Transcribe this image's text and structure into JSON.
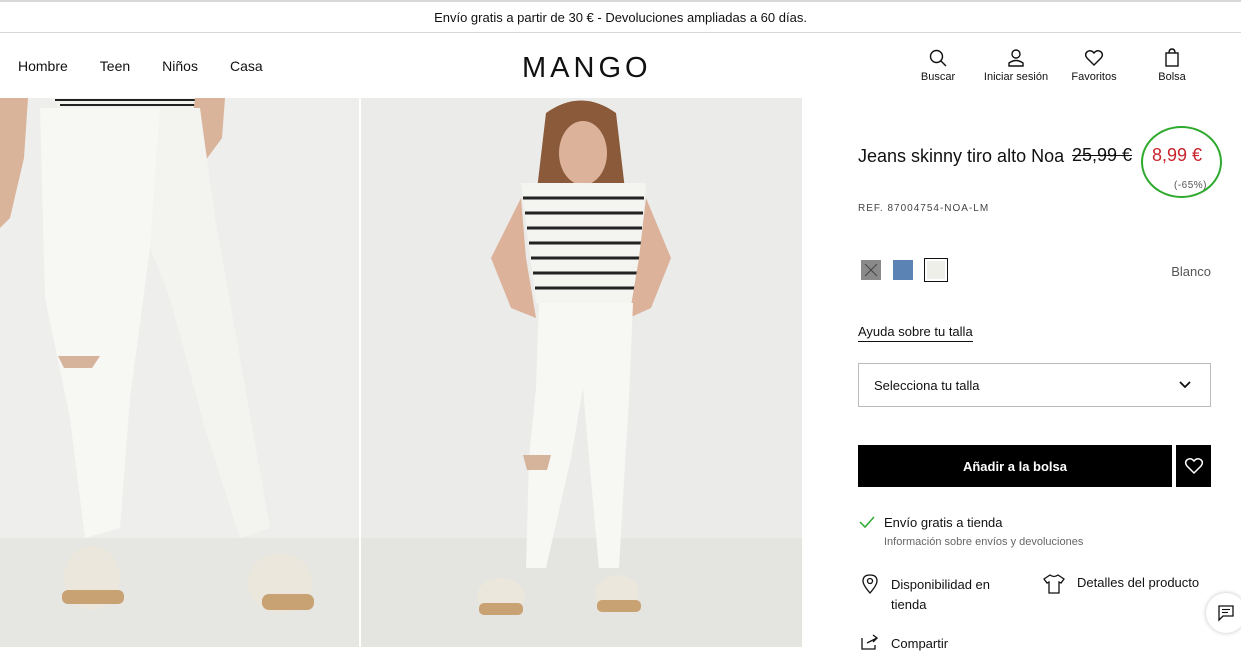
{
  "banner": {
    "text": "Envío gratis a partir de 30 € - Devoluciones ampliadas a 60 días."
  },
  "nav": {
    "items": [
      "Hombre",
      "Teen",
      "Niños",
      "Casa"
    ]
  },
  "logo": {
    "text": "MANGO"
  },
  "tools": {
    "search": "Buscar",
    "login": "Iniciar sesión",
    "favorites": "Favoritos",
    "bag": "Bolsa"
  },
  "product": {
    "title": "Jeans skinny tiro alto Noa",
    "ref": "REF. 87004754-NOA-LM",
    "old_price": "25,99 €",
    "new_price": "8,99 €",
    "discount": "(-65%)",
    "color_name": "Blanco",
    "colors": [
      "#8a8a8a",
      "#5b84b5",
      "#efefea"
    ],
    "price_color": "#c9242b",
    "highlight_color": "#2eaa2e"
  },
  "size": {
    "help": "Ayuda sobre tu talla",
    "select_placeholder": "Selecciona tu talla"
  },
  "actions": {
    "add_to_bag": "Añadir a la bolsa"
  },
  "shipping": {
    "title": "Envío gratis a tienda",
    "subtitle": "Información sobre envíos y devoluciones"
  },
  "links": {
    "availability": "Disponibilidad en tienda",
    "details": "Detalles del producto",
    "share": "Compartir"
  },
  "icons": {
    "search": "search-icon",
    "user": "user-icon",
    "heart": "heart-icon",
    "bag": "bag-icon",
    "check": "check-icon",
    "pin": "location-pin-icon",
    "shirt": "shirt-icon",
    "share": "share-icon",
    "chat": "chat-icon",
    "chevron": "chevron-down-icon"
  }
}
